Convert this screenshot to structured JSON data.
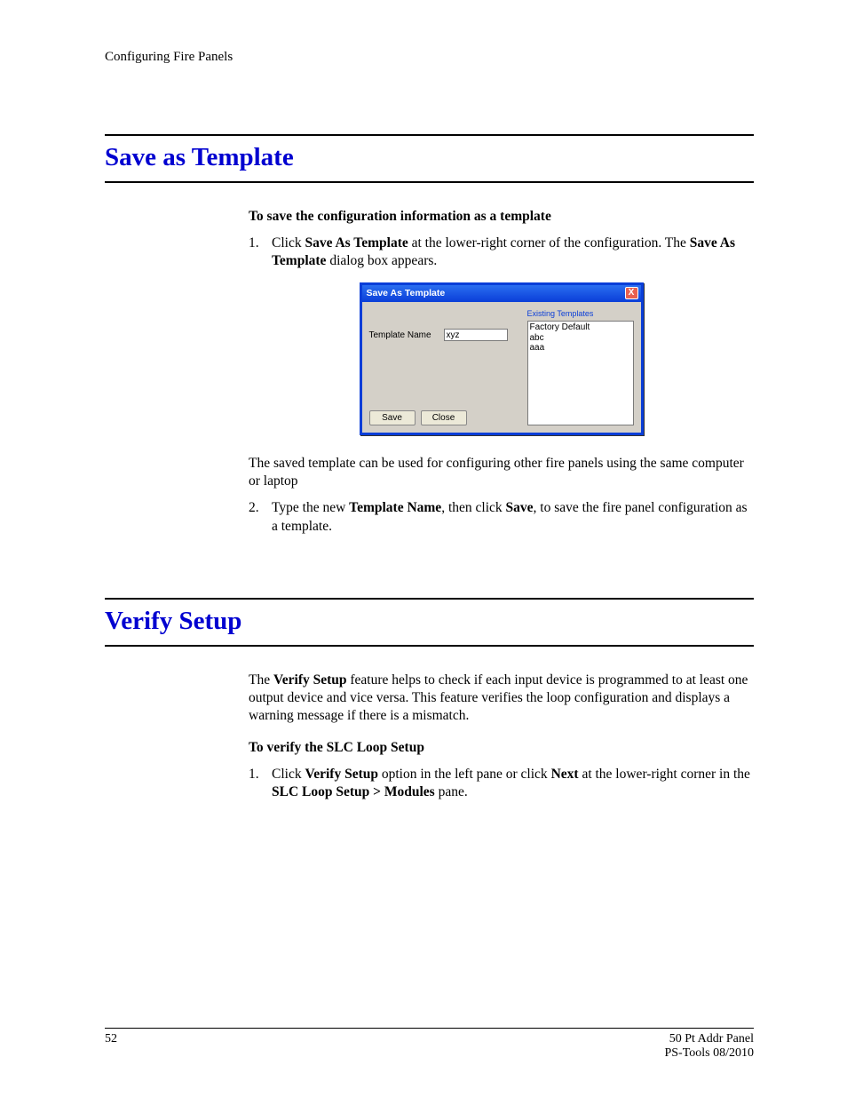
{
  "header": {
    "chapter": "Configuring Fire Panels"
  },
  "section1": {
    "title": "Save as Template",
    "intro_bold": "To save the configuration information as a template",
    "step1_num": "1.",
    "step1_pre": "Click ",
    "step1_b1": "Save As Template",
    "step1_mid": " at the lower-right corner of the configuration. The ",
    "step1_b2": "Save As Template",
    "step1_post": " dialog box appears.",
    "note": "The saved template can be used for configuring other fire panels using the same computer or laptop",
    "step2_num": "2.",
    "step2_pre": "Type the new ",
    "step2_b1": "Template Name",
    "step2_mid": ", then click ",
    "step2_b2": "Save",
    "step2_post": ", to save the fire panel configuration as a template."
  },
  "dialog": {
    "title": "Save As Template",
    "close": "X",
    "label": "Template Name",
    "value": "xyz",
    "save": "Save",
    "close_btn": "Close",
    "group": "Existing Templates",
    "items": [
      "Factory Default",
      "abc",
      "aaa"
    ]
  },
  "section2": {
    "title": "Verify Setup",
    "para_pre": "The ",
    "para_b1": "Verify Setup",
    "para_post": " feature helps to check if each input device is programmed to at least one output device and vice versa. This feature verifies the loop configuration and displays a warning message if there is a mismatch.",
    "sub_bold": "To verify the SLC Loop Setup",
    "step1_num": "1.",
    "step1_pre": "Click ",
    "step1_b1": "Verify Setup",
    "step1_mid": " option in the left pane or click ",
    "step1_b2": "Next",
    "step1_mid2": " at the lower-right corner in the ",
    "step1_b3": "SLC Loop Setup > Modules",
    "step1_post": " pane."
  },
  "footer": {
    "page": "52",
    "right1": "50 Pt Addr Panel",
    "right2": "PS-Tools 08/2010"
  }
}
